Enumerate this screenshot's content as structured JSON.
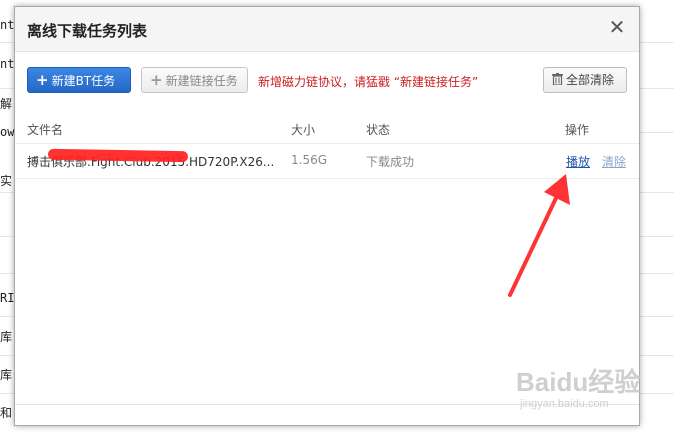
{
  "background": {
    "fragments": [
      "nte",
      "nte",
      "解(",
      "ow",
      "实",
      "RI",
      "库",
      "库",
      "和"
    ]
  },
  "dialog": {
    "title": "离线下载任务列表",
    "close_glyph": "✕"
  },
  "toolbar": {
    "new_bt_label": "新建BT任务",
    "new_link_label": "新建链接任务",
    "plus_glyph": "+",
    "notice": "新增磁力链协议，请猛戳 “新建链接任务”",
    "clear_all_label": "全部清除",
    "trash_glyph": "🗑"
  },
  "table": {
    "headers": {
      "name": "文件名",
      "size": "大小",
      "status": "状态",
      "actions": "操作"
    },
    "rows": [
      {
        "name": "搏击俱乐部.Fight.Club.2015.HD720P.X26...",
        "size": "1.56G",
        "status": "下载成功",
        "play_label": "播放",
        "delete_label": "清除"
      }
    ]
  },
  "watermark": {
    "main": "Baidu经验",
    "sub": "jingyan.baidu.com"
  },
  "colors": {
    "primary": "#2f74d0",
    "notice": "#cc1d1d",
    "link": "#2255aa",
    "arrow": "#ff3333"
  }
}
